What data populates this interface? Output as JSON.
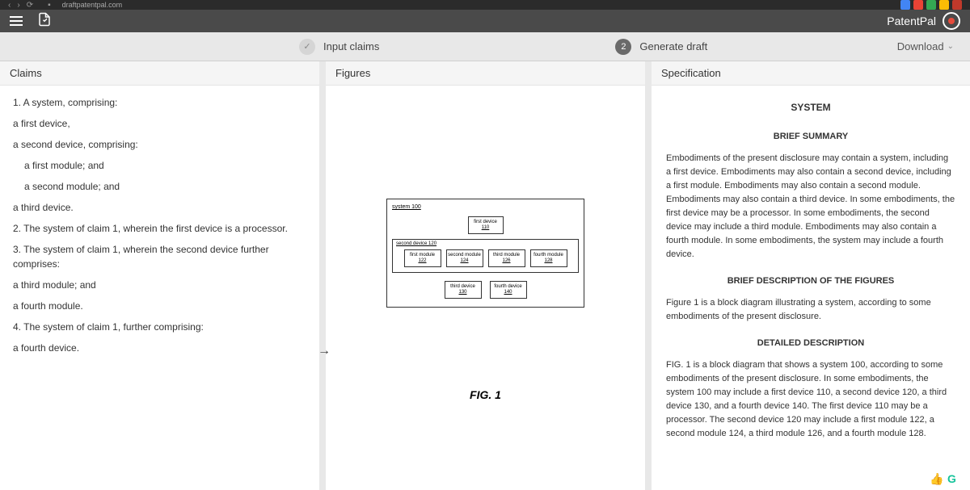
{
  "browser": {
    "url": "draftpatentpal.com"
  },
  "brand": {
    "name": "PatentPal"
  },
  "stepper": {
    "step1": "Input claims",
    "step2num": "2",
    "step2": "Generate draft",
    "download": "Download"
  },
  "panels": {
    "claims": "Claims",
    "figures": "Figures",
    "spec": "Specification"
  },
  "claims": {
    "l1": "1. A system, comprising:",
    "l2": "a first device,",
    "l3": "a second device, comprising:",
    "l4": "a first module; and",
    "l5": "a second module; and",
    "l6": "a third device.",
    "l7": "2. The system of claim 1, wherein the first device is a processor.",
    "l8": "3. The system of claim 1, wherein the second device further comprises:",
    "l9": "a third module; and",
    "l10": "a fourth module.",
    "l11": "4. The system of claim 1, further comprising:",
    "l12": "a fourth device."
  },
  "figure": {
    "system_label": "system 100",
    "first_device": "first device",
    "first_device_num": "110",
    "second_device_label": "second device 120",
    "mod1": "first module",
    "mod1n": "122",
    "mod2": "second module",
    "mod2n": "124",
    "mod3": "third module",
    "mod3n": "126",
    "mod4": "fourth module",
    "mod4n": "128",
    "third_device": "third device",
    "third_device_num": "130",
    "fourth_device": "fourth device",
    "fourth_device_num": "140",
    "caption": "FIG. 1"
  },
  "spec": {
    "title": "SYSTEM",
    "h1": "BRIEF SUMMARY",
    "p1": "Embodiments of the present disclosure may contain a system, including a first device. Embodiments may also contain a second device, including a first module. Embodiments may also contain a second module. Embodiments may also contain a third device. In some embodiments, the first device may be a processor. In some embodiments, the second device may include a third module. Embodiments may also contain a fourth module. In some embodiments, the system may include a fourth device.",
    "h2": "BRIEF DESCRIPTION OF THE FIGURES",
    "p2": "Figure 1 is a block diagram illustrating a system, according to some embodiments of the present disclosure.",
    "h3": "DETAILED DESCRIPTION",
    "p3": "FIG. 1 is a block diagram that shows a system 100, according to some embodiments of the present disclosure. In some embodiments, the system 100 may include a first device 110, a second device 120, a third device 130, and a fourth device 140. The first device 110 may be a processor. The second device 120 may include a first module 122, a second module 124, a third module 126, and a fourth module 128."
  }
}
